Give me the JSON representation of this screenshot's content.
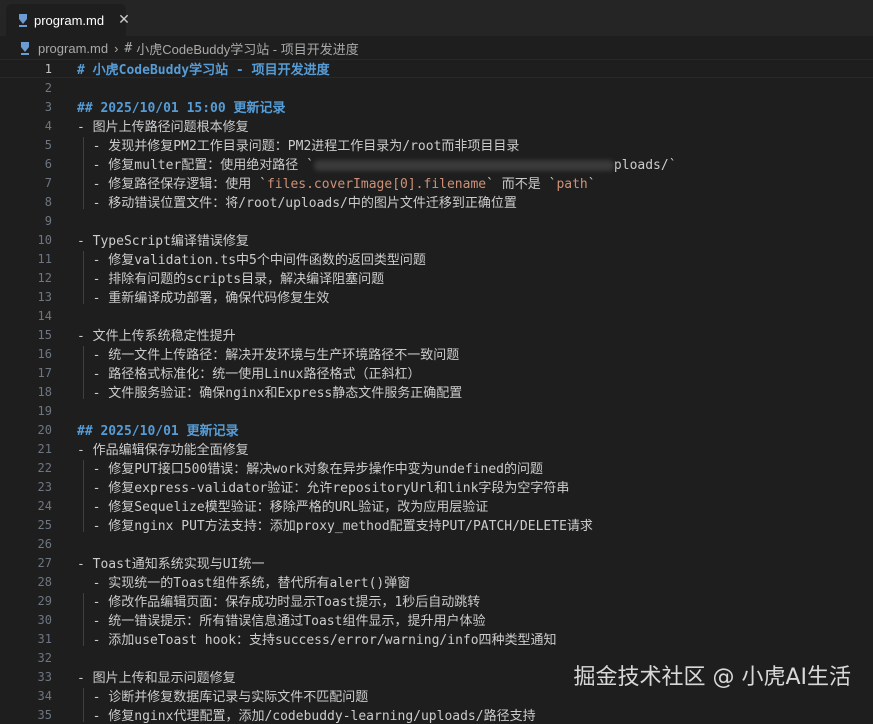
{
  "tab": {
    "label": "program.md",
    "icon": "markdown-icon",
    "close": "✕"
  },
  "breadcrumb": {
    "file": "program.md",
    "separator": "›",
    "hash": "#",
    "section": "小虎CodeBuddy学习站 - 项目开发进度"
  },
  "lines": [
    {
      "n": "1",
      "seg": [
        {
          "t": "# 小虎CodeBuddy学习站 - 项目开发进度",
          "c": "h1"
        }
      ]
    },
    {
      "n": "2",
      "seg": []
    },
    {
      "n": "3",
      "seg": [
        {
          "t": "## 2025/10/01 15:00 更新记录",
          "c": "h2"
        }
      ]
    },
    {
      "n": "4",
      "seg": [
        {
          "t": "- 图片上传路径问题根本修复",
          "c": "list"
        }
      ]
    },
    {
      "n": "5",
      "seg": [
        {
          "t": "  - 发现并修复PM2工作目录问题：PM2进程工作目录为/root而非项目目录",
          "c": "list"
        }
      ]
    },
    {
      "n": "6",
      "seg": [
        {
          "t": "  - 修复multer配置：使用绝对路径 `",
          "c": "list"
        },
        {
          "blur": true
        },
        {
          "t": "ploads/`",
          "c": "list"
        }
      ]
    },
    {
      "n": "7",
      "seg": [
        {
          "t": "  - 修复路径保存逻辑：使用 `",
          "c": "list"
        },
        {
          "t": "files.coverImage[0].filename",
          "c": "inline-code"
        },
        {
          "t": "` 而不是 `",
          "c": "list"
        },
        {
          "t": "path",
          "c": "inline-code"
        },
        {
          "t": "`",
          "c": "list"
        }
      ]
    },
    {
      "n": "8",
      "seg": [
        {
          "t": "  - 移动错误位置文件：将/root/uploads/中的图片文件迁移到正确位置",
          "c": "list"
        }
      ]
    },
    {
      "n": "9",
      "seg": []
    },
    {
      "n": "10",
      "seg": [
        {
          "t": "- TypeScript编译错误修复",
          "c": "list"
        }
      ]
    },
    {
      "n": "11",
      "seg": [
        {
          "t": "  - 修复validation.ts中5个中间件函数的返回类型问题",
          "c": "list"
        }
      ]
    },
    {
      "n": "12",
      "seg": [
        {
          "t": "  - 排除有问题的scripts目录，解决编译阻塞问题",
          "c": "list"
        }
      ]
    },
    {
      "n": "13",
      "seg": [
        {
          "t": "  - 重新编译成功部署，确保代码修复生效",
          "c": "list"
        }
      ]
    },
    {
      "n": "14",
      "seg": []
    },
    {
      "n": "15",
      "seg": [
        {
          "t": "- 文件上传系统稳定性提升",
          "c": "list"
        }
      ]
    },
    {
      "n": "16",
      "seg": [
        {
          "t": "  - 统一文件上传路径：解决开发环境与生产环境路径不一致问题",
          "c": "list"
        }
      ]
    },
    {
      "n": "17",
      "seg": [
        {
          "t": "  - 路径格式标准化：统一使用Linux路径格式（正斜杠）",
          "c": "list"
        }
      ]
    },
    {
      "n": "18",
      "seg": [
        {
          "t": "  - 文件服务验证：确保nginx和Express静态文件服务正确配置",
          "c": "list"
        }
      ]
    },
    {
      "n": "19",
      "seg": []
    },
    {
      "n": "20",
      "seg": [
        {
          "t": "## 2025/10/01 更新记录",
          "c": "h2"
        }
      ]
    },
    {
      "n": "21",
      "seg": [
        {
          "t": "- 作品编辑保存功能全面修复",
          "c": "list"
        }
      ]
    },
    {
      "n": "22",
      "seg": [
        {
          "t": "  - 修复PUT接口500错误：解决work对象在异步操作中变为undefined的问题",
          "c": "list"
        }
      ]
    },
    {
      "n": "23",
      "seg": [
        {
          "t": "  - 修复express-validator验证：允许repositoryUrl和link字段为空字符串",
          "c": "list"
        }
      ]
    },
    {
      "n": "24",
      "seg": [
        {
          "t": "  - 修复Sequelize模型验证：移除严格的URL验证，改为应用层验证",
          "c": "list"
        }
      ]
    },
    {
      "n": "25",
      "seg": [
        {
          "t": "  - 修复nginx PUT方法支持：添加proxy_method配置支持PUT/PATCH/DELETE请求",
          "c": "list"
        }
      ]
    },
    {
      "n": "26",
      "seg": []
    },
    {
      "n": "27",
      "seg": [
        {
          "t": "- Toast通知系统实现与UI统一",
          "c": "list"
        }
      ]
    },
    {
      "n": "28",
      "seg": [
        {
          "t": "  - 实现统一的Toast组件系统，替代所有alert()弹窗",
          "c": "list"
        }
      ]
    },
    {
      "n": "29",
      "seg": [
        {
          "t": "  - 修改作品编辑页面：保存成功时显示Toast提示，1秒后自动跳转",
          "c": "list"
        }
      ]
    },
    {
      "n": "30",
      "seg": [
        {
          "t": "  - 统一错误提示：所有错误信息通过Toast组件显示，提升用户体验",
          "c": "list"
        }
      ]
    },
    {
      "n": "31",
      "seg": [
        {
          "t": "  - 添加useToast hook：支持success/error/warning/info四种类型通知",
          "c": "list"
        }
      ]
    },
    {
      "n": "32",
      "seg": []
    },
    {
      "n": "33",
      "seg": [
        {
          "t": "- 图片上传和显示问题修复",
          "c": "list"
        }
      ]
    },
    {
      "n": "34",
      "seg": [
        {
          "t": "  - 诊断并修复数据库记录与实际文件不匹配问题",
          "c": "list"
        }
      ]
    },
    {
      "n": "35",
      "seg": [
        {
          "t": "  - 修复nginx代理配置，添加/codebuddy-learning/uploads/路径支持",
          "c": "list"
        }
      ]
    }
  ],
  "watermark": "掘金技术社区 @ 小虎AI生活",
  "colors": {
    "heading": "#569cd6",
    "inline_code": "#ce9178",
    "text": "#cccccc",
    "background": "#1e1e1e"
  }
}
